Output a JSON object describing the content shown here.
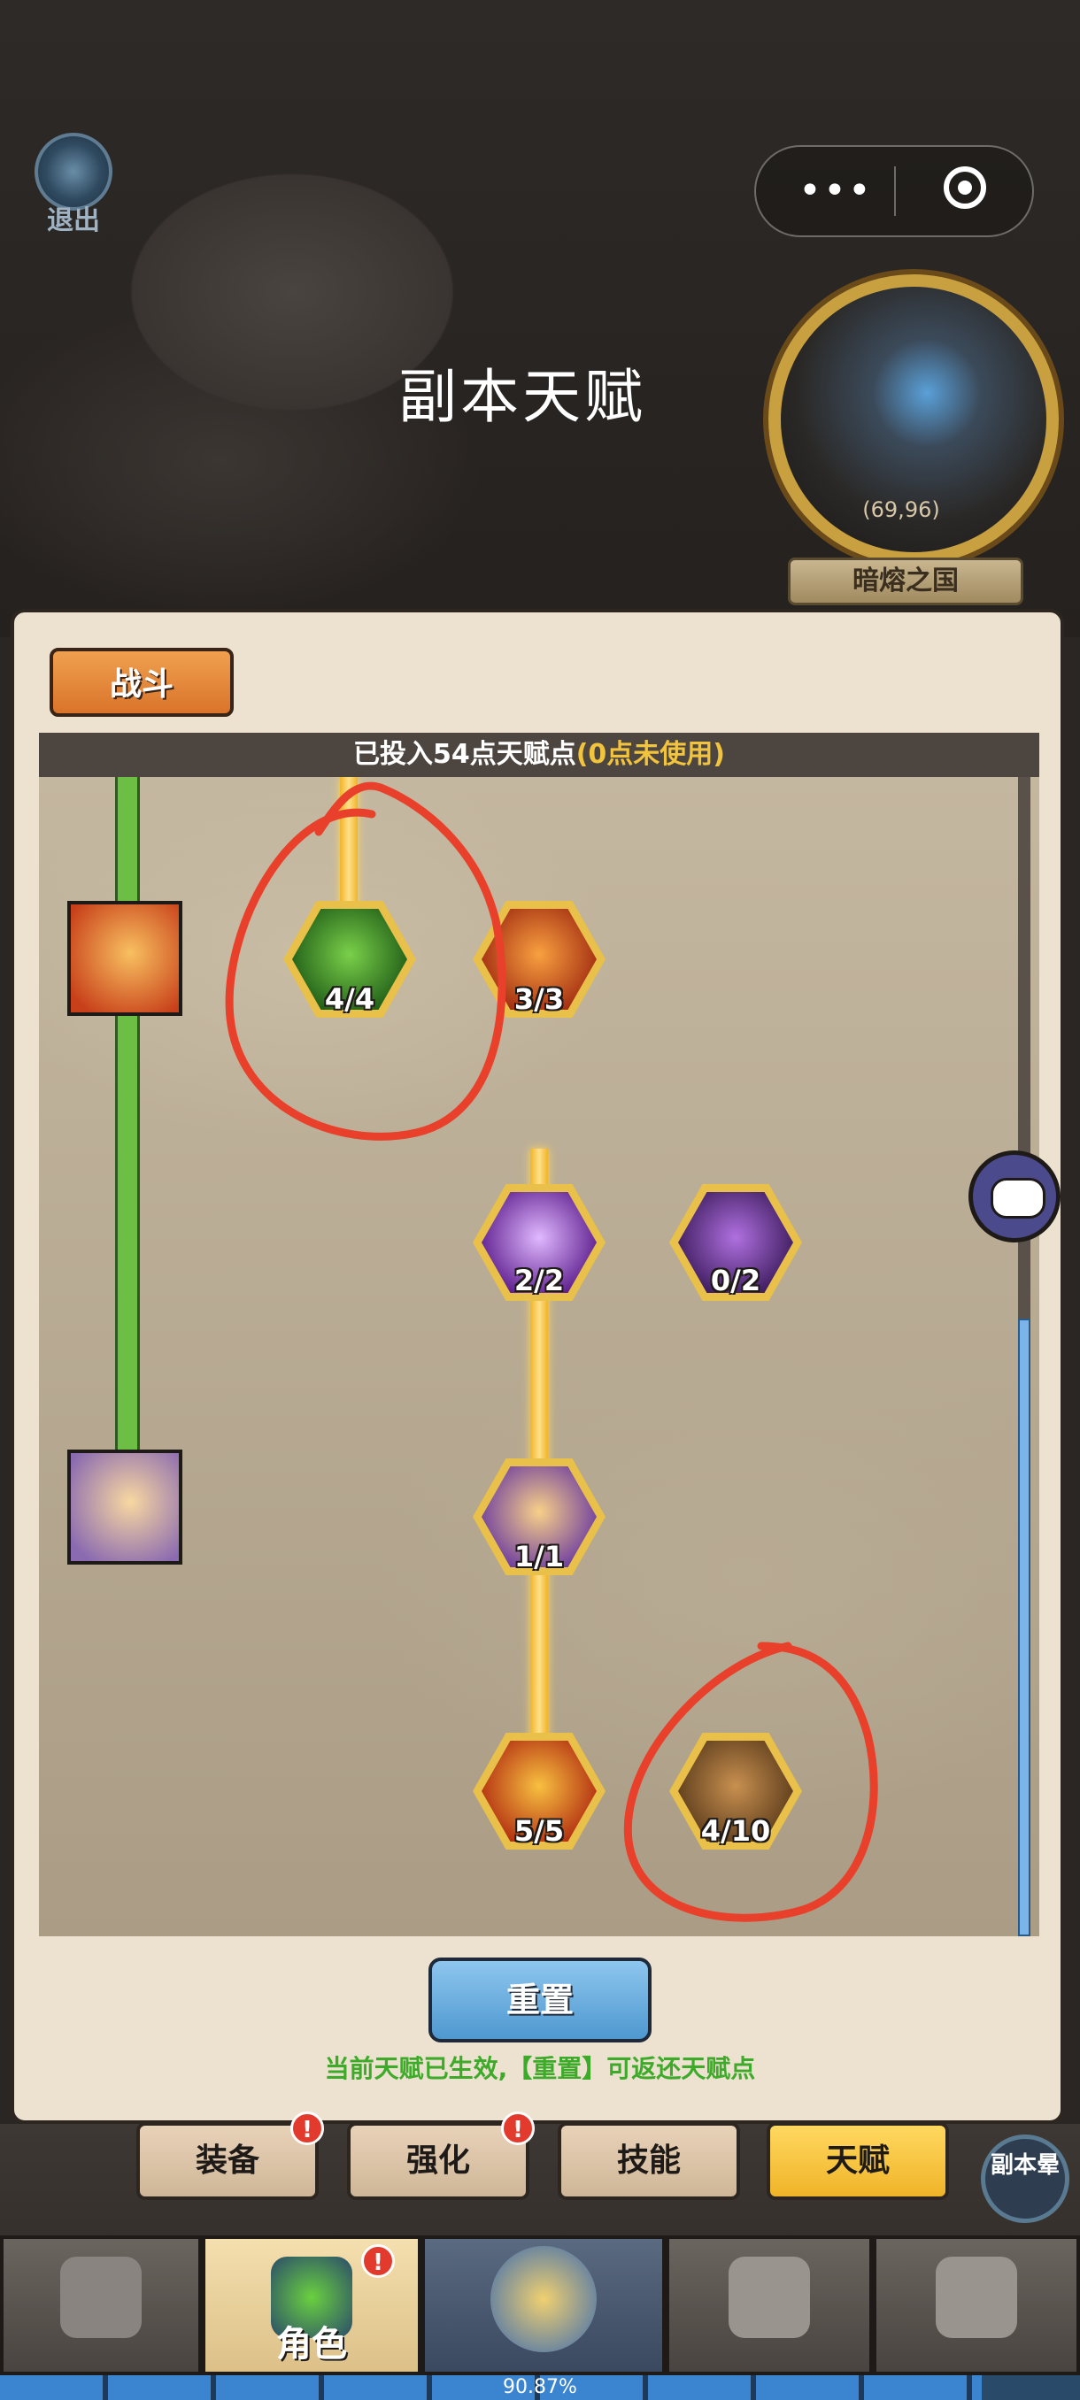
{
  "header": {
    "exit_label": "退出",
    "title": "副本天赋",
    "menu_dots": "•••"
  },
  "minimap": {
    "coords": "(69,96)",
    "region_name": "暗熔之国"
  },
  "panel": {
    "tab_label": "战斗",
    "points_text": "已投入54点天赋点",
    "points_unused": "(0点未使用)",
    "reset_label": "重置",
    "hint": "当前天赋已生效,【重置】可返还天赋点"
  },
  "talents": [
    {
      "id": "shadow-cloak",
      "count": "4/4",
      "colors": [
        "#1e5a16",
        "#7ad04a"
      ]
    },
    {
      "id": "flame-staff",
      "count": "3/3",
      "colors": [
        "#a02a10",
        "#f8a040"
      ]
    },
    {
      "id": "arcane-blade",
      "count": "2/2",
      "colors": [
        "#5a1a8a",
        "#e0b8ff"
      ]
    },
    {
      "id": "shadow-figure",
      "count": "0/2",
      "colors": [
        "#3a1a5a",
        "#b070e0"
      ]
    },
    {
      "id": "swirl-fist",
      "count": "1/1",
      "colors": [
        "#6a3aa0",
        "#f8d088"
      ]
    },
    {
      "id": "fire-slash",
      "count": "5/5",
      "colors": [
        "#b02a10",
        "#f8c040"
      ]
    },
    {
      "id": "iron-gauntlet",
      "count": "4/10",
      "colors": [
        "#5a3a1a",
        "#c89050"
      ]
    }
  ],
  "side_tiles": [
    {
      "id": "flame-staff-tile",
      "colors": [
        "#c8401a",
        "#f8c060"
      ]
    },
    {
      "id": "swirl-tile",
      "colors": [
        "#8a6ab0",
        "#f8d8a0"
      ]
    }
  ],
  "subtabs": [
    {
      "label": "装备",
      "alert": "!"
    },
    {
      "label": "强化",
      "alert": "!"
    },
    {
      "label": "技能"
    },
    {
      "label": "天赋",
      "active": true
    }
  ],
  "dungeon_button": "副本晕",
  "nav": {
    "character_label": "角色",
    "character_alert": "!"
  },
  "progress": {
    "text": "90.87%",
    "value": 0.9087
  },
  "colors": {
    "panel_bg": "#ece2cf",
    "accent_gold": "#f0b428",
    "annotation_red": "#e8402a"
  }
}
